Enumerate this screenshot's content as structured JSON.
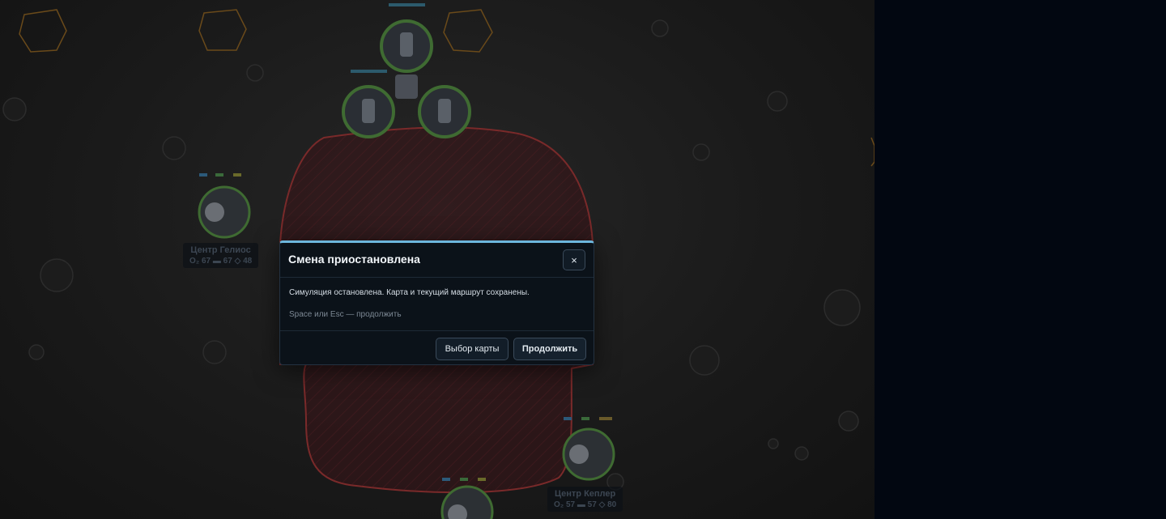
{
  "dialog": {
    "title": "Смена приостановлена",
    "close_label": "×",
    "message": "Симуляция остановлена. Карта и текущий маршрут сохранены.",
    "hint": "Space или Esc — продолжить",
    "map_button": "Выбор карты",
    "continue_button": "Продолжить"
  },
  "stations": [
    {
      "name": "Центр Гелиос",
      "o2": "O₂ 67",
      "energy": "▬ 67",
      "supply": "◇ 48"
    },
    {
      "name": "Центр Кеплер",
      "o2": "O₂ 57",
      "energy": "▬ 57",
      "supply": "◇ 80"
    }
  ],
  "colors": {
    "zone_fill": "#3a1418",
    "zone_stroke": "#7a2a2a",
    "unit_ring": "#3f6b32",
    "dialog_accent": "#6cb6dc"
  }
}
